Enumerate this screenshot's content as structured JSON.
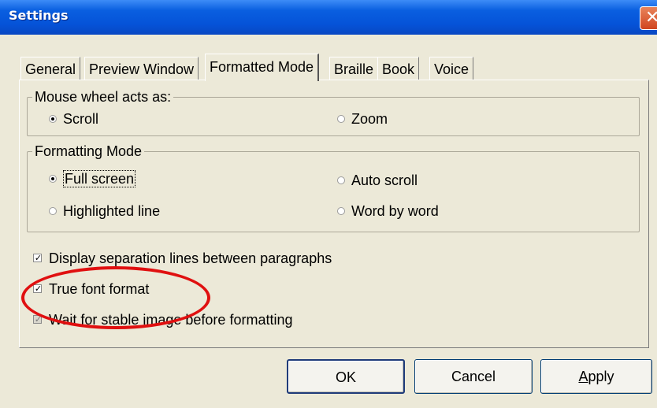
{
  "window": {
    "title": "Settings"
  },
  "tabs": [
    {
      "label": "General",
      "active": false
    },
    {
      "label": "Preview Window",
      "active": false
    },
    {
      "label": "Formatted Mode",
      "active": true
    },
    {
      "label": "Braille",
      "active": false
    },
    {
      "label": "Book",
      "active": false
    },
    {
      "label": "Voice",
      "active": false
    }
  ],
  "mouse_wheel": {
    "legend": "Mouse wheel acts as:",
    "options": [
      {
        "label": "Scroll",
        "selected": true
      },
      {
        "label": "Zoom",
        "selected": false
      }
    ]
  },
  "formatting_mode": {
    "legend": "Formatting Mode",
    "options": [
      {
        "label": "Full screen",
        "selected": true
      },
      {
        "label": "Auto scroll",
        "selected": false
      },
      {
        "label": "Highlighted line",
        "selected": false
      },
      {
        "label": "Word by word",
        "selected": false
      }
    ]
  },
  "checkboxes": [
    {
      "label": "Display separation lines between paragraphs",
      "checked": true
    },
    {
      "label": "True font format",
      "checked": true
    },
    {
      "label": "Wait for stable image before formatting",
      "checked": true,
      "disabled": true
    }
  ],
  "buttons": {
    "ok": "OK",
    "cancel": "Cancel",
    "apply_first": "A",
    "apply_rest": "pply"
  },
  "colors": {
    "titlebar": "#0553d8",
    "annotation": "#e01010",
    "background": "#ece9d8"
  },
  "icons": {
    "close": "close-icon"
  }
}
